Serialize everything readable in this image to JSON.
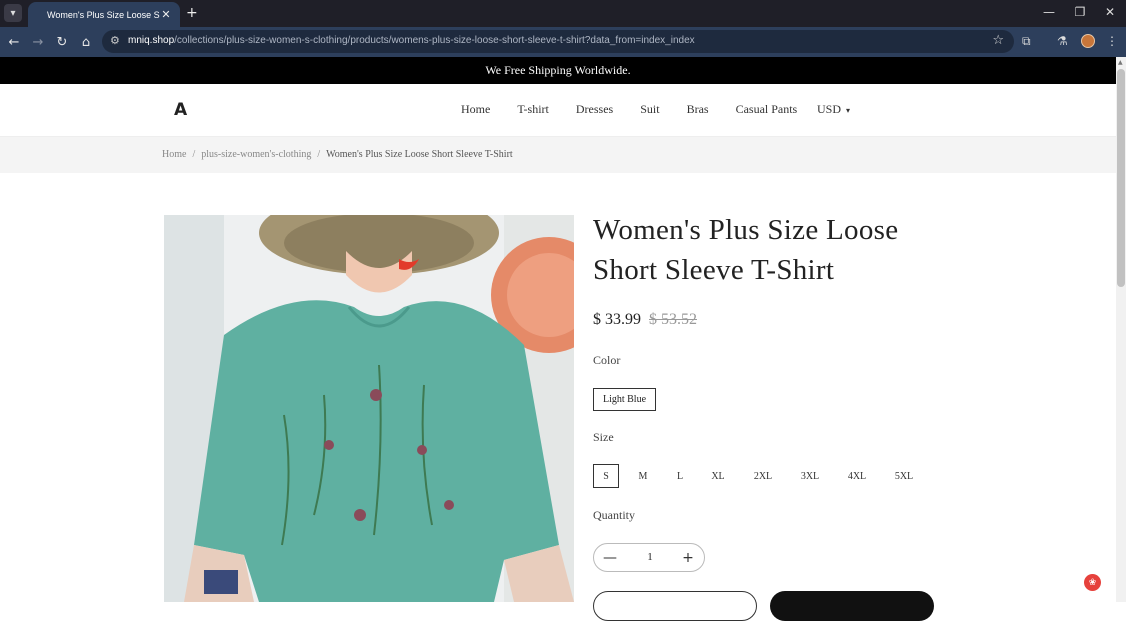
{
  "browser": {
    "tab_title": "Women's Plus Size Loose Short Sleeve T-Shirt",
    "url_domain": "mniq.shop",
    "url_path": "/collections/plus-size-women-s-clothing/products/womens-plus-size-loose-short-sleeve-t-shirt?data_from=index_index",
    "icons": {
      "tab_list": "▾",
      "close_tab": "✕",
      "new_tab": "+",
      "minimize": "—",
      "restore": "❐",
      "close_window": "✕",
      "back": "←",
      "forward": "→",
      "reload": "↻",
      "home": "⌂",
      "site_info": "⚙",
      "bookmark": "☆",
      "extensions": "⧉",
      "labs": "⚗",
      "menu": "⋮"
    }
  },
  "site": {
    "announcement": "We Free Shipping Worldwide.",
    "logo": "A",
    "nav": [
      "Home",
      "T-shirt",
      "Dresses",
      "Suit",
      "Bras",
      "Casual Pants"
    ],
    "currency": "USD",
    "currency_caret": "▾"
  },
  "breadcrumb": {
    "home": "Home",
    "category": "plus-size-women's-clothing",
    "current": "Women's Plus Size Loose Short Sleeve T-Shirt",
    "separator": "/"
  },
  "product": {
    "title": "Women's Plus Size Loose Short Sleeve T-Shirt",
    "price": "$ 33.99",
    "compare_price": "$ 53.52",
    "color_label": "Color",
    "color_value": "Light Blue",
    "size_label": "Size",
    "sizes": [
      "S",
      "M",
      "L",
      "XL",
      "2XL",
      "3XL",
      "4XL",
      "5XL"
    ],
    "selected_size": "S",
    "quantity_label": "Quantity",
    "quantity": "1",
    "qty_minus": "—",
    "qty_plus": "+"
  },
  "floating_badge": "❀",
  "scroll_up": "▲"
}
